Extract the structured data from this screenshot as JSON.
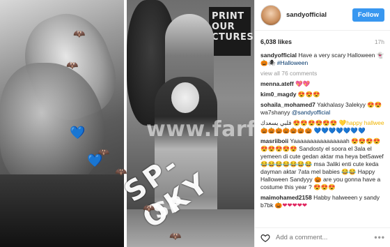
{
  "post": {
    "watermark": "www.farfesh.com",
    "sign_text": "PRINT\nOUR\nCTURES",
    "scrawl_text": "SP-OKY",
    "scrawl_text_2": "SP"
  },
  "header": {
    "username": "sandyofficial",
    "follow_label": "Follow"
  },
  "stats": {
    "likes": "6,038 likes",
    "time": "17h"
  },
  "caption": {
    "user": "sandyofficial",
    "text": "Have a very scary Halloween",
    "emojis": "👻🎃🕷",
    "hashtag": "#Halloween"
  },
  "view_all": "view all 76 comments",
  "comments": [
    {
      "user": "menna.ateff",
      "text": "",
      "emojis": "💖💖"
    },
    {
      "user": "kim0_magdy",
      "text": "",
      "emojis": "😍😍😍"
    },
    {
      "user": "sohaila_mohamed7",
      "text": "Yakhalasy 3alekyy",
      "emojis": "😍😍",
      "mention": "@sandyofficial",
      "prefix": "wa7shanyy "
    },
    {
      "user": "",
      "text": "قلبي يسعدك",
      "emojis": "😍😍😍😍😍😍 💛happy hallwee🎃🎃🎃🎃🎃🎃🎃",
      "extra": "💙💙💙💙💙💙💙"
    },
    {
      "user": "masriiboii",
      "text": "Yaaaaaaaaaaaaaaaah 😍😍😍😍😍😍😍😍😍 Sandosty el soora el 3ala el yemeen di cute gedan aktar ma heya bet5awef 😂😂😂😂😂😂😂 msa 3aliki enti cute keda dayman aktar 7ata mel babies 😂😂 Happy Halloween Sandyyy 🎃 are you gonna have a costume this year ? 😍😍😍",
      "emojis": ""
    },
    {
      "user": "maimohamed2158",
      "text": "Habby halweeen y sandy b7bk",
      "emojis": "🎃❤❤❤❤❤"
    }
  ],
  "footer": {
    "placeholder": "Add a comment...",
    "more": "•••"
  },
  "colors": {
    "follow": "#3897f0",
    "link": "#003569",
    "muted": "#999999"
  },
  "icons": [
    "heart-icon",
    "more-icon",
    "bat-icon",
    "blue-heart-icon"
  ]
}
